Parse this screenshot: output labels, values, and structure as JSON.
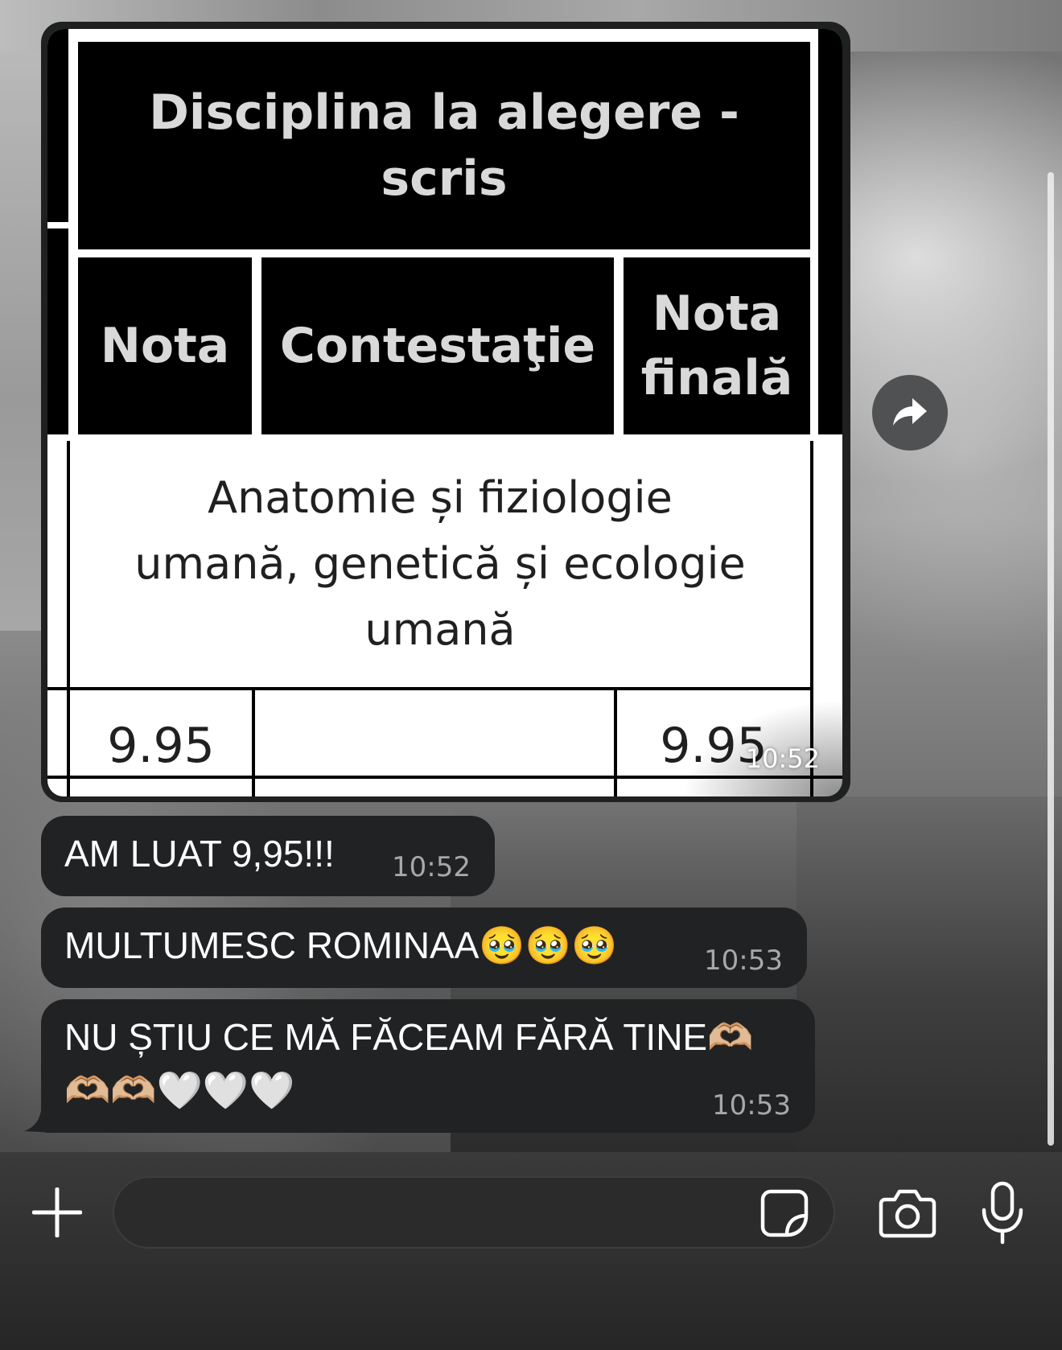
{
  "image_message": {
    "table": {
      "header_title_line1": "Disciplina la alegere -",
      "header_title_line2": "scris",
      "col_nota": "Nota",
      "col_contestatie": "Contestaţie",
      "col_nota_finala_line1": "Nota",
      "col_nota_finala_line2": "finală",
      "subject_line1": "Anatomie și fiziologie",
      "subject_line2": "umană, genetică și ecologie",
      "subject_line3": "umană",
      "nota_value": "9.95",
      "contestatie_value": "",
      "nota_finala_value": "9.95"
    },
    "time": "10:52"
  },
  "messages": [
    {
      "text": "AM LUAT 9,95!!!",
      "time": "10:52"
    },
    {
      "text": "MULTUMESC ROMINAA🥹🥹🥹",
      "time": "10:53"
    },
    {
      "text_line1": "NU ȘTIU CE MĂ FĂCEAM FĂRĂ TINE🫶🏼",
      "text_line2": "🫶🏼🫶🏼🤍🤍🤍",
      "time": "10:53"
    }
  ],
  "icons": {
    "forward": "forward-arrow-icon",
    "plus": "plus-icon",
    "sticker": "sticker-icon",
    "camera": "camera-icon",
    "microphone": "microphone-icon"
  },
  "colors": {
    "bubble": "#212223",
    "timestamp": "#a8a8a8",
    "input_bar": "#262626"
  }
}
